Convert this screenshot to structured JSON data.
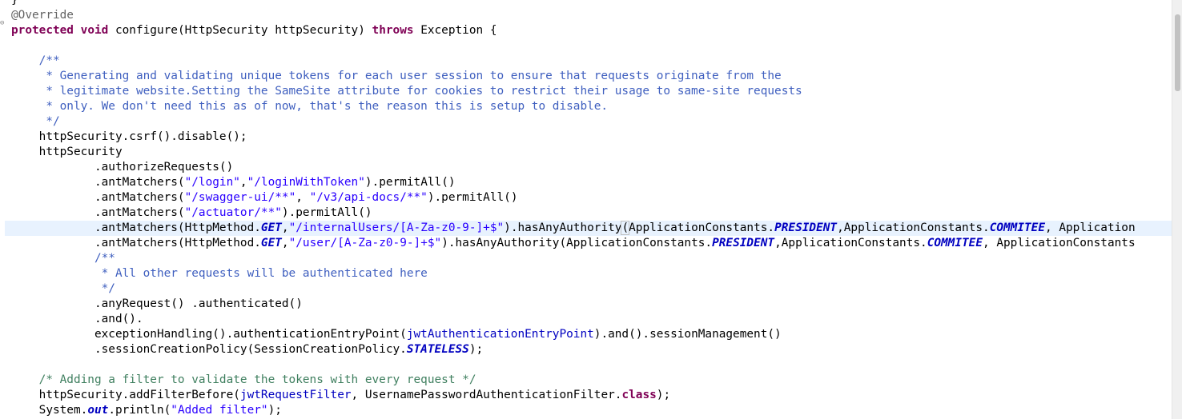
{
  "editor": {
    "language": "java",
    "current_line_index": 15,
    "lines": [
      [
        {
          "t": "}",
          "c": "plain"
        }
      ],
      [
        {
          "t": "@Override",
          "c": "ann"
        }
      ],
      [
        {
          "t": "protected",
          "c": "kw"
        },
        {
          "t": " ",
          "c": "plain"
        },
        {
          "t": "void",
          "c": "kw"
        },
        {
          "t": " configure(HttpSecurity ",
          "c": "plain"
        },
        {
          "t": "httpSecurity",
          "c": "plain"
        },
        {
          "t": ") ",
          "c": "plain"
        },
        {
          "t": "throws",
          "c": "kw"
        },
        {
          "t": " Exception {",
          "c": "plain"
        }
      ],
      [
        {
          "t": "",
          "c": "plain"
        }
      ],
      [
        {
          "t": "    /**",
          "c": "doc"
        }
      ],
      [
        {
          "t": "     * Generating and validating unique tokens for each user session to ensure that requests originate from the",
          "c": "doc"
        }
      ],
      [
        {
          "t": "     * legitimate website.Setting the SameSite attribute for cookies to restrict their usage to same-site requests",
          "c": "doc"
        }
      ],
      [
        {
          "t": "     * only. We don't need this as of now, that's the reason this is setup to disable.",
          "c": "doc"
        }
      ],
      [
        {
          "t": "     */",
          "c": "doc"
        }
      ],
      [
        {
          "t": "    ",
          "c": "plain"
        },
        {
          "t": "httpSecurity",
          "c": "plain"
        },
        {
          "t": ".csrf().disable();",
          "c": "plain"
        }
      ],
      [
        {
          "t": "    ",
          "c": "plain"
        },
        {
          "t": "httpSecurity",
          "c": "plain"
        }
      ],
      [
        {
          "t": "            .authorizeRequests()",
          "c": "plain"
        }
      ],
      [
        {
          "t": "            .antMatchers(",
          "c": "plain"
        },
        {
          "t": "\"/login\"",
          "c": "str"
        },
        {
          "t": ",",
          "c": "plain"
        },
        {
          "t": "\"/loginWithToken\"",
          "c": "str"
        },
        {
          "t": ").permitAll()",
          "c": "plain"
        }
      ],
      [
        {
          "t": "            .antMatchers(",
          "c": "plain"
        },
        {
          "t": "\"/swagger-ui/**\"",
          "c": "str"
        },
        {
          "t": ", ",
          "c": "plain"
        },
        {
          "t": "\"/v3/api-docs/**\"",
          "c": "str"
        },
        {
          "t": ").permitAll()",
          "c": "plain"
        }
      ],
      [
        {
          "t": "            .antMatchers(",
          "c": "plain"
        },
        {
          "t": "\"/actuator/**\"",
          "c": "str"
        },
        {
          "t": ").permitAll()",
          "c": "plain"
        }
      ],
      [
        {
          "t": "            .antMatchers(HttpMethod.",
          "c": "plain"
        },
        {
          "t": "GET",
          "c": "sfld"
        },
        {
          "t": ",",
          "c": "plain"
        },
        {
          "t": "\"/internalUsers/[A-Za-z0-9-]+$\"",
          "c": "str"
        },
        {
          "t": ").hasAnyAuthority",
          "c": "plain"
        },
        {
          "t": "(",
          "c": "paren-hl"
        },
        {
          "t": "ApplicationConstants.",
          "c": "plain"
        },
        {
          "t": "PRESIDENT",
          "c": "sfld"
        },
        {
          "t": ",ApplicationConstants.",
          "c": "plain"
        },
        {
          "t": "COMMITEE",
          "c": "sfld"
        },
        {
          "t": ", Application",
          "c": "plain"
        }
      ],
      [
        {
          "t": "            .antMatchers(HttpMethod.",
          "c": "plain"
        },
        {
          "t": "GET",
          "c": "sfld"
        },
        {
          "t": ",",
          "c": "plain"
        },
        {
          "t": "\"/user/[A-Za-z0-9-]+$\"",
          "c": "str"
        },
        {
          "t": ").hasAnyAuthority(ApplicationConstants.",
          "c": "plain"
        },
        {
          "t": "PRESIDENT",
          "c": "sfld"
        },
        {
          "t": ",ApplicationConstants.",
          "c": "plain"
        },
        {
          "t": "COMMITEE",
          "c": "sfld"
        },
        {
          "t": ", ApplicationConstants",
          "c": "plain"
        }
      ],
      [
        {
          "t": "            /**",
          "c": "doc"
        }
      ],
      [
        {
          "t": "             * All other requests will be authenticated here",
          "c": "doc"
        }
      ],
      [
        {
          "t": "             */",
          "c": "doc"
        }
      ],
      [
        {
          "t": "            .anyRequest() .authenticated()",
          "c": "plain"
        }
      ],
      [
        {
          "t": "            .and().",
          "c": "plain"
        }
      ],
      [
        {
          "t": "            exceptionHandling().authenticationEntryPoint(",
          "c": "plain"
        },
        {
          "t": "jwtAuthenticationEntryPoint",
          "c": "fld"
        },
        {
          "t": ").and().sessionManagement()",
          "c": "plain"
        }
      ],
      [
        {
          "t": "            .sessionCreationPolicy(SessionCreationPolicy.",
          "c": "plain"
        },
        {
          "t": "STATELESS",
          "c": "sfld"
        },
        {
          "t": ");",
          "c": "plain"
        }
      ],
      [
        {
          "t": "",
          "c": "plain"
        }
      ],
      [
        {
          "t": "    /* Adding a filter to validate the tokens with every request */",
          "c": "cmt"
        }
      ],
      [
        {
          "t": "    ",
          "c": "plain"
        },
        {
          "t": "httpSecurity",
          "c": "plain"
        },
        {
          "t": ".addFilterBefore(",
          "c": "plain"
        },
        {
          "t": "jwtRequestFilter",
          "c": "fld"
        },
        {
          "t": ", UsernamePasswordAuthenticationFilter.",
          "c": "plain"
        },
        {
          "t": "class",
          "c": "kw"
        },
        {
          "t": ");",
          "c": "plain"
        }
      ],
      [
        {
          "t": "    System.",
          "c": "plain"
        },
        {
          "t": "out",
          "c": "sfld"
        },
        {
          "t": ".println(",
          "c": "plain"
        },
        {
          "t": "\"Added filter\"",
          "c": "str"
        },
        {
          "t": ");",
          "c": "plain"
        }
      ]
    ]
  }
}
